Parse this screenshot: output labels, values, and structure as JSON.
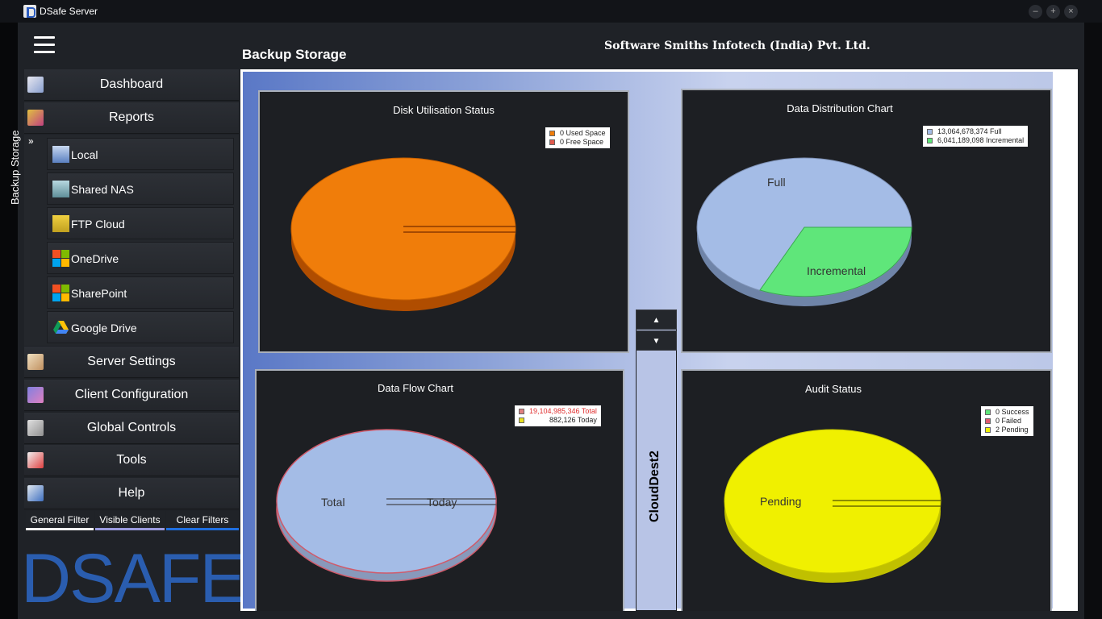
{
  "window": {
    "title": "DSafe Server",
    "controls": [
      "–",
      "+",
      "×"
    ]
  },
  "header": {
    "page_title": "Backup Storage",
    "company": "Software Smiths Infotech (India) Pvt. Ltd."
  },
  "sidebar": {
    "top_items": [
      {
        "label": "Dashboard",
        "icon": "dashboard-icon"
      },
      {
        "label": "Reports",
        "icon": "reports-icon"
      }
    ],
    "backup_group": {
      "label": "Backup Storage",
      "items": [
        {
          "label": "Local",
          "icon": "local-icon"
        },
        {
          "label": "Shared NAS",
          "icon": "nas-icon"
        },
        {
          "label": "FTP Cloud",
          "icon": "ftp-icon"
        },
        {
          "label": "OneDrive",
          "icon": "onedrive-icon"
        },
        {
          "label": "SharePoint",
          "icon": "sharepoint-icon"
        },
        {
          "label": "Google Drive",
          "icon": "google-drive-icon"
        }
      ]
    },
    "bottom_items": [
      {
        "label": "Server Settings",
        "icon": "server-settings-icon"
      },
      {
        "label": "Client Configuration",
        "icon": "client-config-icon"
      },
      {
        "label": "Global Controls",
        "icon": "global-controls-icon"
      },
      {
        "label": "Tools",
        "icon": "tools-icon"
      },
      {
        "label": "Help",
        "icon": "help-icon"
      }
    ],
    "filters": [
      {
        "label": "General Filter",
        "color": "#ffffff"
      },
      {
        "label": "Visible Clients",
        "color": "#9b9be0"
      },
      {
        "label": "Clear Filters",
        "color": "#1f6fe0"
      }
    ],
    "logo_text": "DSAFE"
  },
  "main": {
    "cloud_label": "CloudDest2",
    "scroll_up": "▲",
    "scroll_down": "▼"
  },
  "chart_data": [
    {
      "type": "pie",
      "title": "Disk Utilisation Status",
      "legend": [
        {
          "label": "0 Used Space",
          "value": 0,
          "color": "#f07d0a"
        },
        {
          "label": "0 Free Space",
          "value": 0,
          "color": "#e05a4e"
        }
      ]
    },
    {
      "type": "pie",
      "title": "Data Distribution Chart",
      "legend": [
        {
          "label": "13,064,678,374 Full",
          "value": 13064678374,
          "color": "#a4bce6"
        },
        {
          "label": "6,041,189,098 Incremental",
          "value": 6041189098,
          "color": "#5fe67a"
        }
      ],
      "slice_labels": [
        "Full",
        "Incremental"
      ]
    },
    {
      "type": "pie",
      "title": "Data Flow Chart",
      "legend": [
        {
          "label": "19,104,985,346 Total",
          "value": 19104985346,
          "color": "#e08080"
        },
        {
          "label": "882,126 Today",
          "value": 882126,
          "color": "#e8e020"
        }
      ],
      "slice_labels": [
        "Total",
        "Today"
      ]
    },
    {
      "type": "pie",
      "title": "Audit Status",
      "legend": [
        {
          "label": "0 Success",
          "value": 0,
          "color": "#5fe67a"
        },
        {
          "label": "0 Failed",
          "value": 0,
          "color": "#e05a6e"
        },
        {
          "label": "2 Pending",
          "value": 2,
          "color": "#f0f000"
        }
      ],
      "slice_labels": [
        "Pending"
      ]
    }
  ]
}
